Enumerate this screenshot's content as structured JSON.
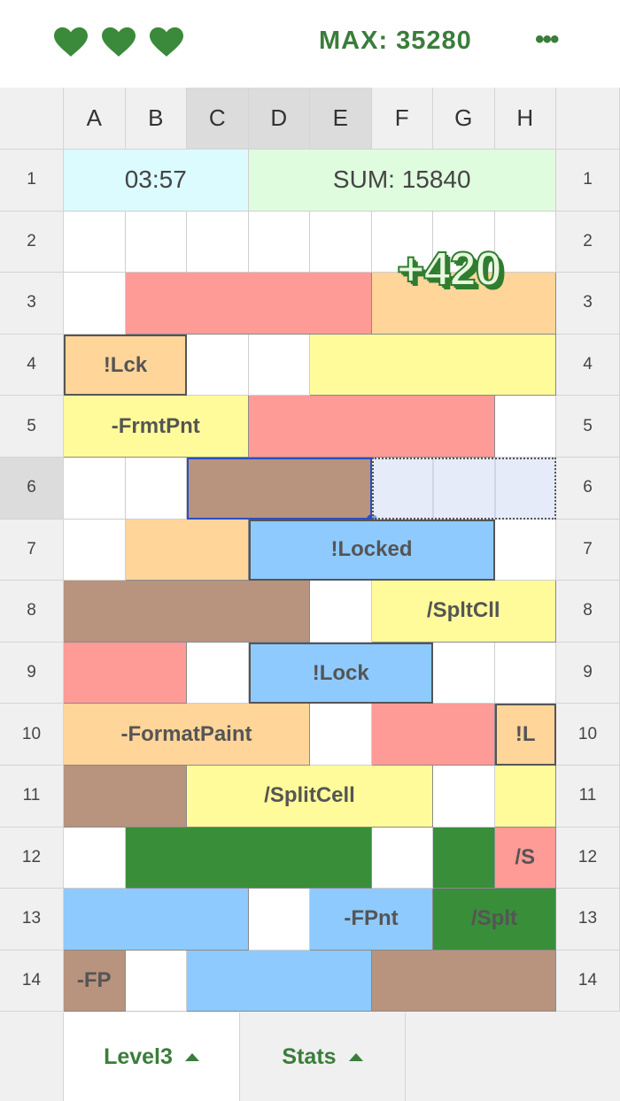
{
  "header": {
    "lives": 3,
    "max_label": "MAX: 35280",
    "menu_icon": "more-horizontal-icon",
    "heart_icon": "heart-icon",
    "heart_color": "#3b8a3b"
  },
  "grid": {
    "columns": [
      "A",
      "B",
      "C",
      "D",
      "E",
      "F",
      "G",
      "H"
    ],
    "rows": [
      "1",
      "2",
      "3",
      "4",
      "5",
      "6",
      "7",
      "8",
      "9",
      "10",
      "11",
      "12",
      "13",
      "14"
    ],
    "selected_columns": [
      "C",
      "D",
      "E"
    ],
    "selected_row": "6",
    "timer": "03:57",
    "sum": "SUM: 15840",
    "score_popup": "+420",
    "colors": {
      "red": "#ff9b97",
      "orange": "#ffd59a",
      "yellow": "#fffb9a",
      "brown": "#b8937e",
      "blue": "#8ecafd",
      "green": "#398e3a",
      "timer_bg": "#dcfbfe",
      "sum_bg": "#e0fcdf",
      "selection": "#2a4fc0"
    },
    "blocks": [
      {
        "row": 3,
        "col": "B",
        "span": 4,
        "color": "red",
        "label": ""
      },
      {
        "row": 3,
        "col": "F",
        "span": 3,
        "color": "orange",
        "label": ""
      },
      {
        "row": 4,
        "col": "A",
        "span": 2,
        "color": "orange",
        "label": "!Lck",
        "locked": true
      },
      {
        "row": 4,
        "col": "E",
        "span": 4,
        "color": "yellow",
        "label": ""
      },
      {
        "row": 5,
        "col": "A",
        "span": 3,
        "color": "yellow",
        "label": "-FrmtPnt"
      },
      {
        "row": 5,
        "col": "D",
        "span": 4,
        "color": "red",
        "label": ""
      },
      {
        "row": 6,
        "col": "C",
        "span": 3,
        "color": "brown",
        "label": "",
        "selected": true
      },
      {
        "row": 7,
        "col": "B",
        "span": 2,
        "color": "orange",
        "label": ""
      },
      {
        "row": 7,
        "col": "D",
        "span": 4,
        "color": "blue",
        "label": "!Locked",
        "locked": true
      },
      {
        "row": 8,
        "col": "A",
        "span": 4,
        "color": "brown",
        "label": ""
      },
      {
        "row": 8,
        "col": "F",
        "span": 3,
        "color": "yellow",
        "label": "/SpltCll"
      },
      {
        "row": 9,
        "col": "A",
        "span": 2,
        "color": "red",
        "label": ""
      },
      {
        "row": 9,
        "col": "D",
        "span": 3,
        "color": "blue",
        "label": "!Lock",
        "locked": true
      },
      {
        "row": 10,
        "col": "A",
        "span": 4,
        "color": "orange",
        "label": "-FormatPaint"
      },
      {
        "row": 10,
        "col": "F",
        "span": 2,
        "color": "red",
        "label": ""
      },
      {
        "row": 10,
        "col": "H",
        "span": 1,
        "color": "orange",
        "label": "!L",
        "locked": true
      },
      {
        "row": 11,
        "col": "A",
        "span": 2,
        "color": "brown",
        "label": ""
      },
      {
        "row": 11,
        "col": "C",
        "span": 4,
        "color": "yellow",
        "label": "/SplitCell"
      },
      {
        "row": 11,
        "col": "H",
        "span": 1,
        "color": "yellow",
        "label": ""
      },
      {
        "row": 12,
        "col": "B",
        "span": 4,
        "color": "green",
        "label": ""
      },
      {
        "row": 12,
        "col": "G",
        "span": 1,
        "color": "green",
        "label": ""
      },
      {
        "row": 12,
        "col": "H",
        "span": 1,
        "color": "red",
        "label": "/S"
      },
      {
        "row": 13,
        "col": "A",
        "span": 3,
        "color": "blue",
        "label": ""
      },
      {
        "row": 13,
        "col": "E",
        "span": 2,
        "color": "blue",
        "label": "-FPnt"
      },
      {
        "row": 13,
        "col": "G",
        "span": 2,
        "color": "green",
        "label": "/Splt"
      },
      {
        "row": 14,
        "col": "A",
        "span": 1,
        "color": "brown",
        "label": "-FP"
      },
      {
        "row": 14,
        "col": "C",
        "span": 3,
        "color": "blue",
        "label": ""
      },
      {
        "row": 14,
        "col": "F",
        "span": 3,
        "color": "brown",
        "label": ""
      }
    ]
  },
  "tabs": [
    {
      "label": "Level3",
      "active": true,
      "icon": "triangle-up-icon"
    },
    {
      "label": "Stats",
      "active": false,
      "icon": "triangle-up-icon"
    }
  ]
}
